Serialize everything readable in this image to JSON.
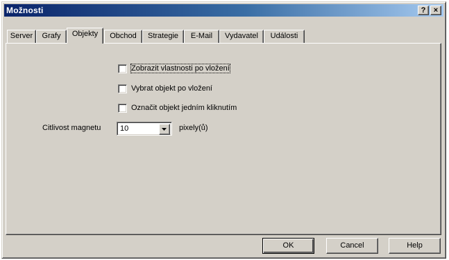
{
  "window": {
    "title": "Možnosti"
  },
  "titlebar_buttons": {
    "help": "?",
    "close": "×"
  },
  "tabs": [
    {
      "label": "Server",
      "active": false
    },
    {
      "label": "Grafy",
      "active": false
    },
    {
      "label": "Objekty",
      "active": true
    },
    {
      "label": "Obchod",
      "active": false
    },
    {
      "label": "Strategie",
      "active": false
    },
    {
      "label": "E-Mail",
      "active": false
    },
    {
      "label": "Vydavatel",
      "active": false
    },
    {
      "label": "Události",
      "active": false
    }
  ],
  "options": {
    "show_properties": {
      "label": "Zobrazit vlastnosti po vložení",
      "checked": false
    },
    "select_object": {
      "label": "Vybrat objekt po vložení",
      "checked": false
    },
    "single_click": {
      "label": "Označit objekt jedním kliknutím",
      "checked": false
    }
  },
  "magnet": {
    "label": "Citlivost magnetu",
    "value": "10",
    "unit": "pixely(ů)"
  },
  "buttons": {
    "ok": "OK",
    "cancel": "Cancel",
    "help": "Help"
  }
}
